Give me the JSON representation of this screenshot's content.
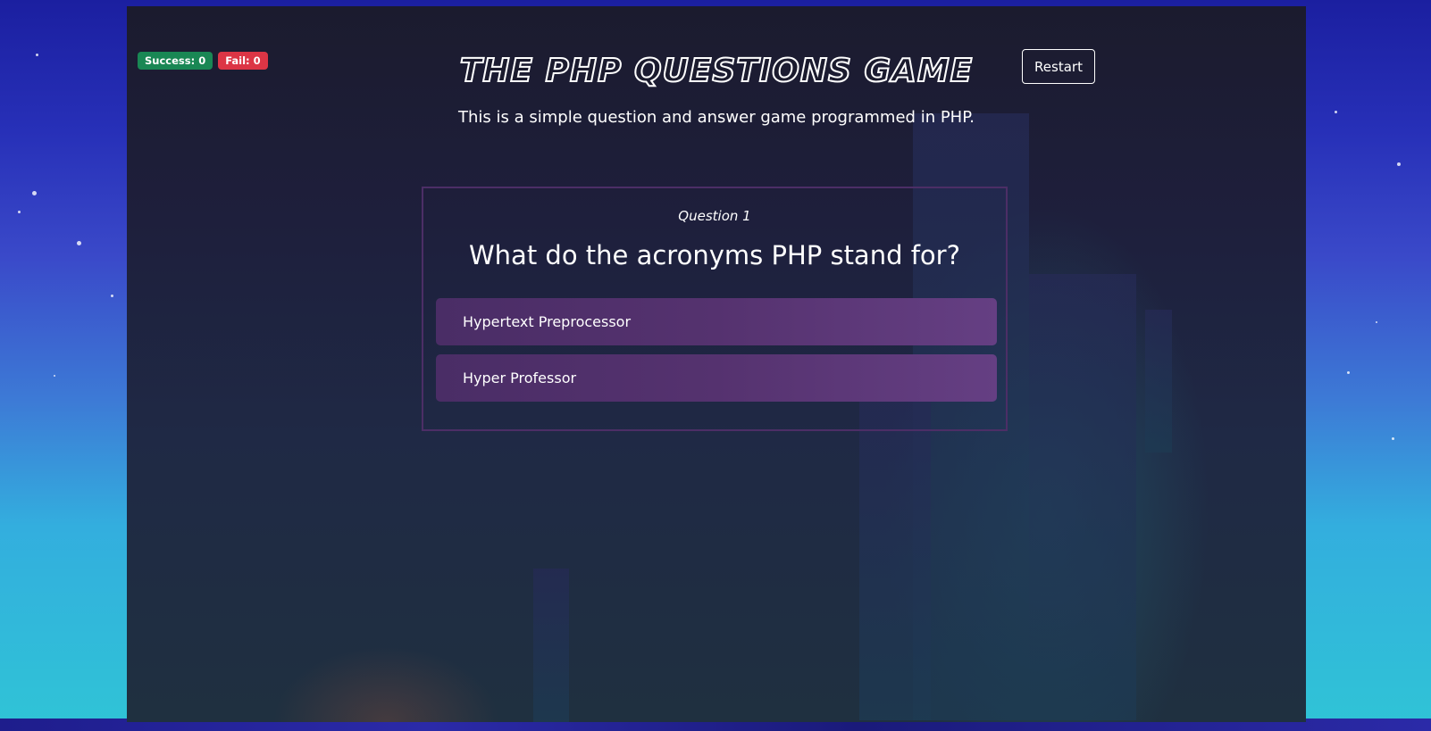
{
  "header": {
    "title": "THE PHP QUESTIONS GAME",
    "subtitle": "This is a simple question and answer game programmed in PHP.",
    "restart_label": "Restart"
  },
  "scores": {
    "success_label": "Success: 0",
    "fail_label": "Fail: 0"
  },
  "question": {
    "number_label": "Question 1",
    "text": "What do the acronyms PHP stand for?",
    "answers": [
      {
        "label": "Hypertext Preprocessor"
      },
      {
        "label": "Hyper Professor"
      }
    ]
  },
  "colors": {
    "success": "#198754",
    "fail": "#dc3545",
    "answer_bg": "#55326f",
    "question_border": "#4c2e66"
  }
}
